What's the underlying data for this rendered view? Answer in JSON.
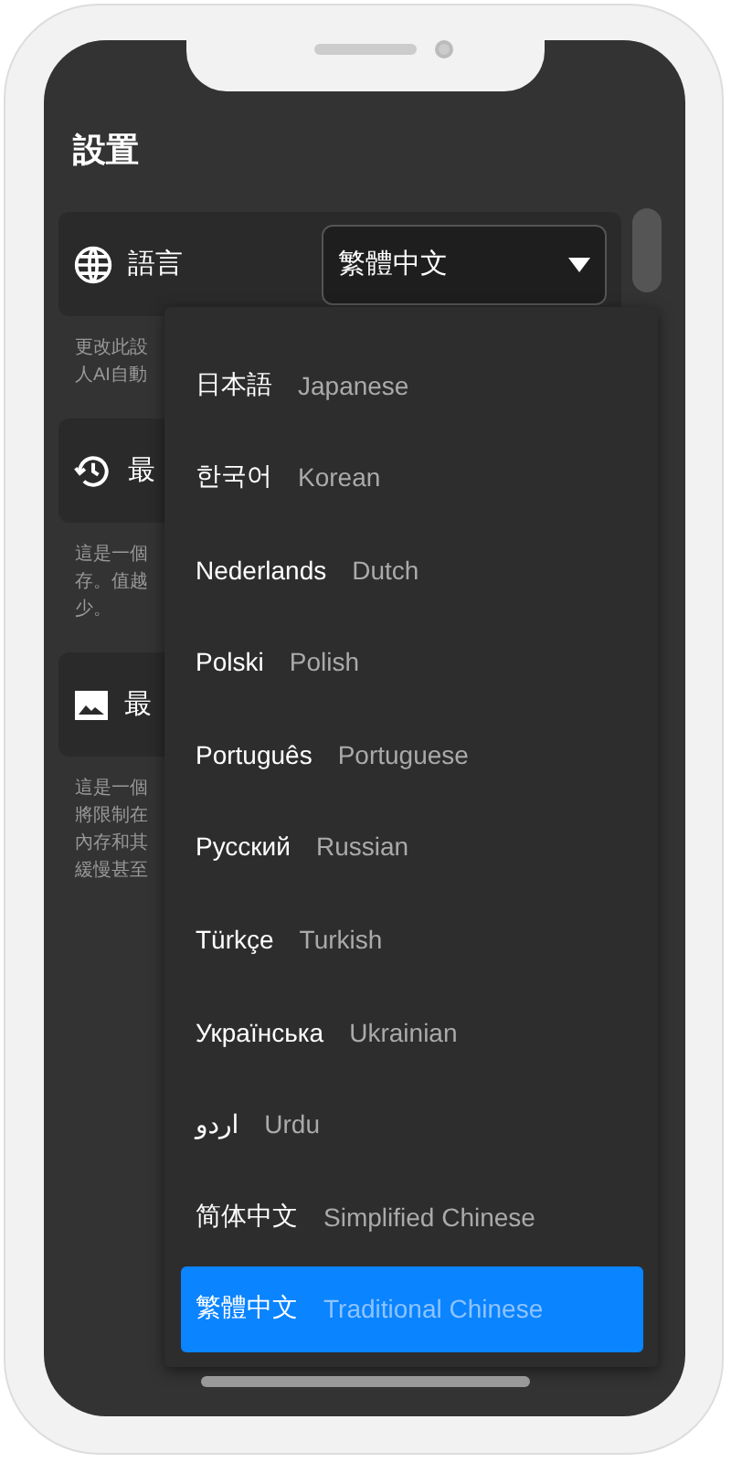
{
  "header": {
    "title": "設置"
  },
  "settings": [
    {
      "kind": "globe",
      "title": "語言",
      "description_lines": [
        "更改此設",
        "人AI自動"
      ],
      "select": {
        "value": "繁體中文"
      }
    },
    {
      "kind": "history",
      "title": "最",
      "description_lines": [
        "這是一個",
        "存。值越",
        "少。"
      ]
    },
    {
      "kind": "image",
      "title": "最",
      "description_lines": [
        "這是一個",
        "將限制在",
        "內存和其",
        "緩慢甚至"
      ]
    }
  ],
  "dropdown": {
    "options": [
      {
        "native": "日本語",
        "english": "Japanese",
        "selected": false
      },
      {
        "native": "한국어",
        "english": "Korean",
        "selected": false
      },
      {
        "native": "Nederlands",
        "english": "Dutch",
        "selected": false
      },
      {
        "native": "Polski",
        "english": "Polish",
        "selected": false
      },
      {
        "native": "Português",
        "english": "Portuguese",
        "selected": false
      },
      {
        "native": "Русский",
        "english": "Russian",
        "selected": false
      },
      {
        "native": "Türkçe",
        "english": "Turkish",
        "selected": false
      },
      {
        "native": "Українська",
        "english": "Ukrainian",
        "selected": false
      },
      {
        "native": "اردو",
        "english": "Urdu",
        "selected": false
      },
      {
        "native": "简体中文",
        "english": "Simplified Chinese",
        "selected": false
      },
      {
        "native": "繁體中文",
        "english": "Traditional Chinese",
        "selected": true
      }
    ]
  }
}
